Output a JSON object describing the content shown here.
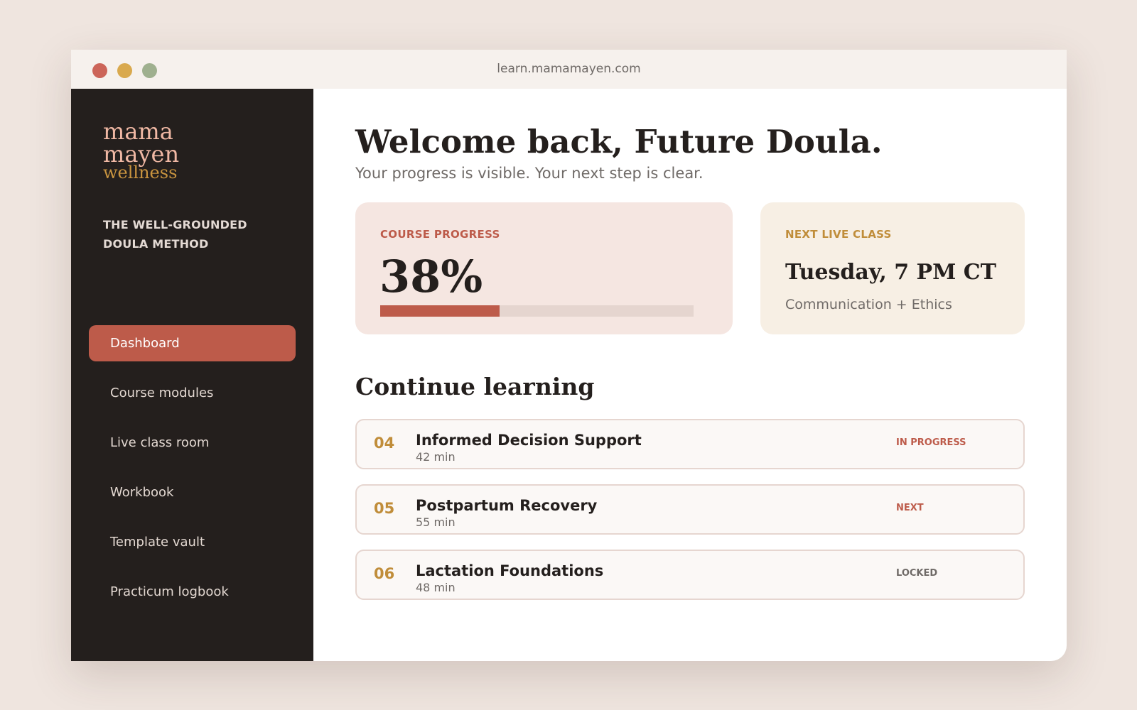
{
  "browser": {
    "url": "learn.mamamayen.com"
  },
  "sidebar": {
    "logo": {
      "line1": "mama",
      "line2": "mayen",
      "line3": "wellness"
    },
    "program_name": "THE WELL-GROUNDED DOULA METHOD",
    "nav_items": [
      {
        "label": "Dashboard",
        "active": true
      },
      {
        "label": "Course modules",
        "active": false
      },
      {
        "label": "Live class room",
        "active": false
      },
      {
        "label": "Workbook",
        "active": false
      },
      {
        "label": "Template vault",
        "active": false
      },
      {
        "label": "Practicum logbook",
        "active": false
      }
    ]
  },
  "header": {
    "title": "Welcome back, Future Doula.",
    "subtitle": "Your progress is visible. Your next step is clear."
  },
  "progress_card": {
    "label": "COURSE PROGRESS",
    "value_text": "38%",
    "fraction": 0.38
  },
  "next_class_card": {
    "label": "NEXT LIVE CLASS",
    "day": "Tuesday, 7 PM CT",
    "topic": "Communication + Ethics"
  },
  "continue_learning": {
    "title": "Continue learning",
    "modules": [
      {
        "number": "04",
        "title": "Informed Decision Support",
        "duration": "42 min",
        "status": "IN PROGRESS",
        "status_color": "#bd5b4a"
      },
      {
        "number": "05",
        "title": "Postpartum Recovery",
        "duration": "55 min",
        "status": "NEXT",
        "status_color": "#bd5b4a"
      },
      {
        "number": "06",
        "title": "Lactation Foundations",
        "duration": "48 min",
        "status": "LOCKED",
        "status_color": "#6f6a67"
      }
    ]
  },
  "colors": {
    "accent": "#bd5b4a",
    "gold": "#c08d3a",
    "sidebar_bg": "#241f1d",
    "logo_pink": "#f0b8a4"
  }
}
